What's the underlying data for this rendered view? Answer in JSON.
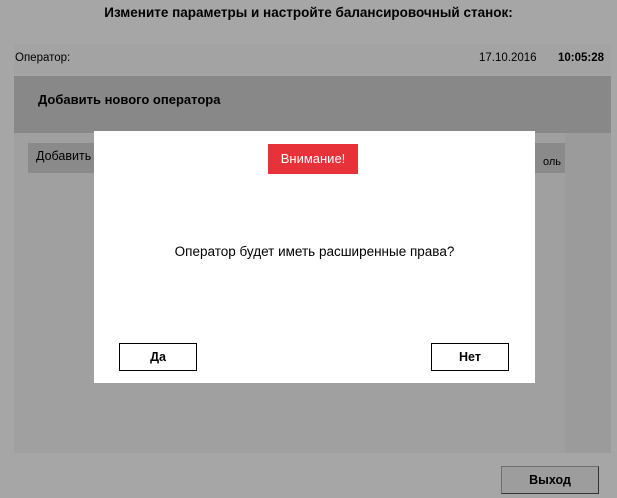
{
  "window": {
    "title": "Измените параметры и настройте балансировочный станок:"
  },
  "status_bar": {
    "operator_label": "Оператор:",
    "date": "17.10.2016",
    "time": "10:05:28"
  },
  "panel": {
    "header_title": "Добавить нового оператора",
    "add_tab_label": "Добавить",
    "password_tab_label": "оль"
  },
  "dialog": {
    "badge_text": "Внимание!",
    "badge_color": "#e8323a",
    "message": "Оператор будет иметь расширенные права?",
    "yes_label": "Да",
    "no_label": "Нет"
  },
  "footer": {
    "exit_label": "Выход"
  }
}
